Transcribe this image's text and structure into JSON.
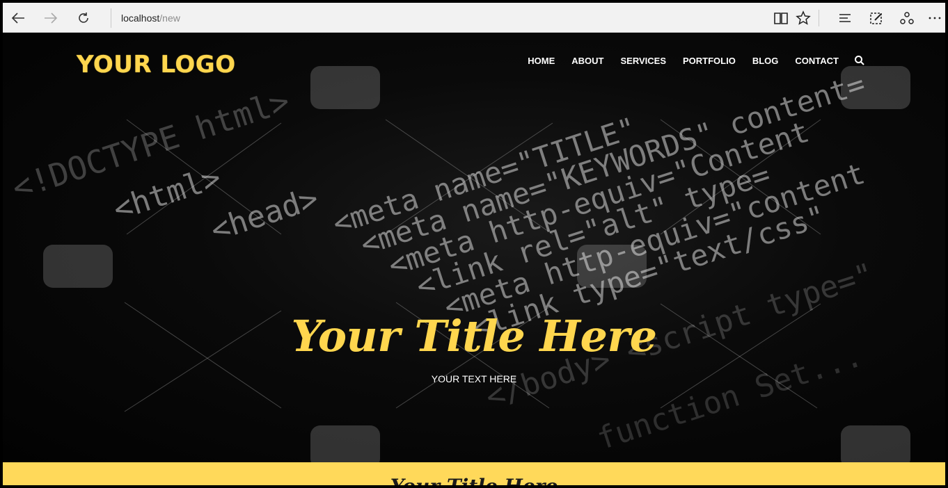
{
  "browser": {
    "address_host": "localhost",
    "address_path": "/new",
    "icons": [
      "back-icon",
      "forward-icon",
      "refresh-icon",
      "reading-view-icon",
      "favorite-star-icon",
      "hub-icon",
      "web-note-icon",
      "share-icon",
      "more-icon"
    ]
  },
  "site": {
    "logo": "YOUR LOGO",
    "menu": [
      "HOME",
      "ABOUT",
      "SERVICES",
      "PORTFOLIO",
      "BLOG",
      "CONTACT"
    ],
    "hero_title": "Your Title Here",
    "hero_subtitle": "YOUR TEXT HERE",
    "band_text": "Your Title Here",
    "colors": {
      "accent": "#ffd64e",
      "band": "#ffd95a",
      "background": "#050505"
    }
  }
}
